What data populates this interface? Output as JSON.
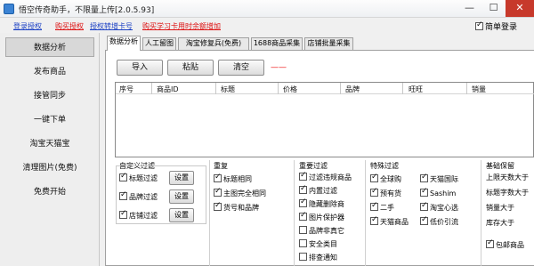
{
  "window": {
    "title": "悟空传奇助手，不限量上传[2.0.5.93]",
    "minimize_glyph": "—",
    "maximize_glyph": "☐",
    "close_glyph": "✕"
  },
  "toplinks": [
    {
      "label": "登录授权",
      "color": "blue"
    },
    {
      "label": "购买授权",
      "color": "red"
    },
    {
      "label": "授权转增卡号",
      "color": "blue"
    },
    {
      "label": "购买学习卡用时余额增加",
      "color": "red"
    }
  ],
  "login_check": {
    "label": "简单登录",
    "checked": true
  },
  "nav": [
    {
      "label": "数据分析",
      "active": true
    },
    {
      "label": "发布商品",
      "active": false
    },
    {
      "label": "接管同步",
      "active": false
    },
    {
      "label": "一键下单",
      "active": false
    },
    {
      "label": "淘宝天猫宝",
      "active": false
    },
    {
      "label": "清理图片(免费)",
      "active": false
    },
    {
      "label": "免费开始",
      "active": false
    }
  ],
  "tabs": [
    {
      "label": "数据分析",
      "active": true
    },
    {
      "label": "人工留图",
      "active": false
    },
    {
      "label": "淘宝修复兵(免费)",
      "active": false
    },
    {
      "label": "1688商品采集",
      "active": false
    },
    {
      "label": "店铺批量采集",
      "active": false
    }
  ],
  "actions": {
    "import": "导入",
    "paste": "粘贴",
    "clear": "清空",
    "dash": "——"
  },
  "table": {
    "columns": [
      "序号",
      "商品ID",
      "标题",
      "价格",
      "品牌",
      "旺旺",
      "销量"
    ]
  },
  "custom_filter": {
    "title": "自定义过滤",
    "options": [
      {
        "label": "标题过滤",
        "checked": true,
        "button": "设置"
      },
      {
        "label": "品牌过滤",
        "checked": true,
        "button": "设置"
      },
      {
        "label": "店铺过滤",
        "checked": true,
        "button": "设置"
      }
    ]
  },
  "dedupe": {
    "title": "重复",
    "options": [
      {
        "label": "标题相同",
        "checked": true
      },
      {
        "label": "主图完全相同",
        "checked": true
      },
      {
        "label": "货号和品牌",
        "checked": true
      }
    ]
  },
  "focus_filter": {
    "title": "重要过滤",
    "options": [
      {
        "label": "过滤违规商品",
        "checked": true
      },
      {
        "label": "内置过滤",
        "checked": true
      },
      {
        "label": "隐藏删除商",
        "checked": true
      },
      {
        "label": "图片保护器",
        "checked": true
      },
      {
        "label": "品牌非真它",
        "checked": false
      },
      {
        "label": "安全类目",
        "checked": false
      },
      {
        "label": "排查通知",
        "checked": false
      }
    ]
  },
  "special_filter": {
    "title": "特殊过滤",
    "left": [
      {
        "label": "全球购",
        "checked": true
      },
      {
        "label": "预有货",
        "checked": true
      },
      {
        "label": "二手",
        "checked": true
      },
      {
        "label": "天猫商品",
        "checked": true
      }
    ],
    "right": [
      {
        "label": "天猫国际",
        "checked": true
      },
      {
        "label": "Sashim",
        "checked": true
      },
      {
        "label": "淘宝心选",
        "checked": true
      },
      {
        "label": "低价引流",
        "checked": true
      }
    ]
  },
  "basic": {
    "title": "基础保留",
    "lines": [
      "上限天数大于",
      "标题字数大于",
      "销量大于",
      "库存大于"
    ],
    "bottom_option": {
      "label": "包邮商品",
      "checked": true
    }
  }
}
